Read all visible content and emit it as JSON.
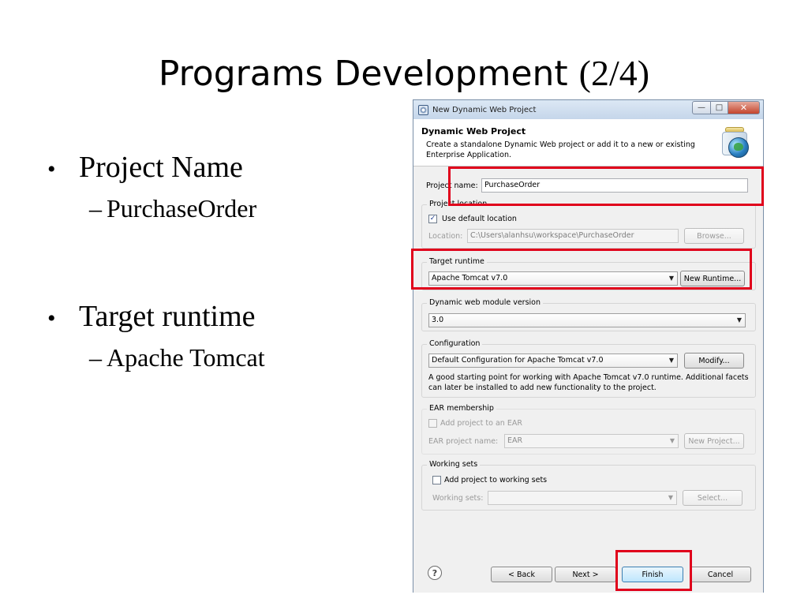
{
  "slide": {
    "title_sans": "Programs Development ",
    "title_serif": "(2/4)",
    "bullets": [
      {
        "label": "Project Name",
        "sub": "PurchaseOrder"
      },
      {
        "label": "Target runtime",
        "sub": "Apache Tomcat"
      }
    ],
    "bullet_glyph": "•",
    "dash_glyph": "–"
  },
  "window": {
    "title": "New Dynamic Web Project",
    "controls": {
      "minimize": "—",
      "maximize": "□",
      "close": "✕"
    },
    "header": {
      "title": "Dynamic Web Project",
      "description": "Create a standalone Dynamic Web project or add it to a new or existing Enterprise Application."
    },
    "project_name": {
      "label": "Project name:",
      "value": "PurchaseOrder"
    },
    "project_location": {
      "legend": "Project location",
      "use_default_label": "Use default location",
      "use_default_checked": true,
      "location_label": "Location:",
      "location_value": "C:\\Users\\alanhsu\\workspace\\PurchaseOrder",
      "browse_label": "Browse..."
    },
    "target_runtime": {
      "legend": "Target runtime",
      "selected": "Apache Tomcat v7.0",
      "new_runtime_label": "New Runtime..."
    },
    "module_version": {
      "legend": "Dynamic web module version",
      "selected": "3.0"
    },
    "configuration": {
      "legend": "Configuration",
      "selected": "Default Configuration for Apache Tomcat v7.0",
      "modify_label": "Modify...",
      "description": "A good starting point for working with Apache Tomcat v7.0 runtime. Additional facets can later be installed to add new functionality to the project."
    },
    "ear": {
      "legend": "EAR membership",
      "add_label": "Add project to an EAR",
      "add_checked": false,
      "name_label": "EAR project name:",
      "name_value": "EAR",
      "new_project_label": "New Project..."
    },
    "working_sets": {
      "legend": "Working sets",
      "add_label": "Add project to working sets",
      "add_checked": false,
      "sets_label": "Working sets:",
      "sets_value": "",
      "select_label": "Select..."
    },
    "footer": {
      "help": "?",
      "back_label": "< Back",
      "next_label": "Next >",
      "finish_label": "Finish",
      "cancel_label": "Cancel"
    }
  },
  "colors": {
    "highlight": "#e0001b",
    "dialog_bg": "#f0f0f0",
    "titlebar": "#c5d6ea"
  },
  "icons": {
    "window": "eclipse-window-icon",
    "header": "web-project-jar-globe-icon",
    "dropdown": "chevron-down-icon",
    "help": "help-question-icon"
  }
}
